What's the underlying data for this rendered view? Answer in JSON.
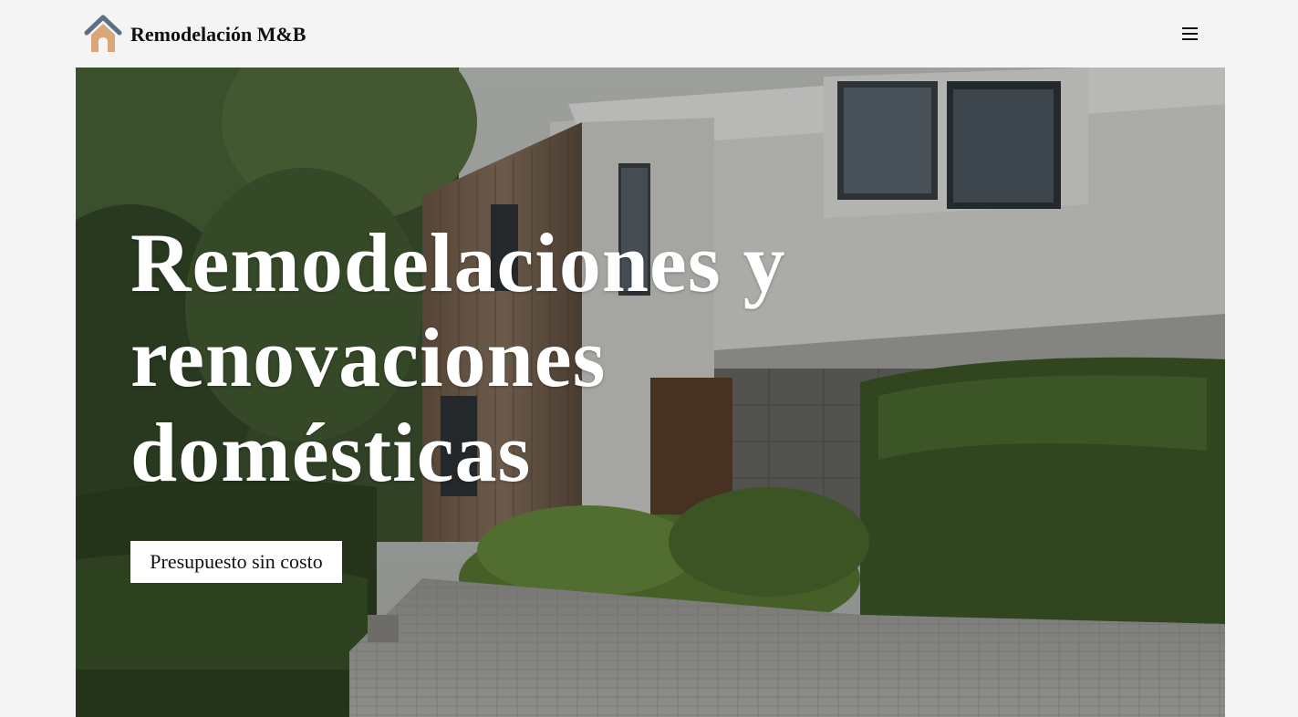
{
  "header": {
    "brand": "Remodelación M&B",
    "logo_icon": "house-icon",
    "menu_icon": "hamburger-menu-icon"
  },
  "hero": {
    "headline": "Remodelaciones y renovaciones domésticas",
    "cta_label": "Presupuesto sin costo"
  },
  "colors": {
    "page_bg": "#f4f4f4",
    "roof": "#5b6f86",
    "house_body": "#d9a67a",
    "headline_text": "#ffffff",
    "cta_bg": "#ffffff"
  }
}
